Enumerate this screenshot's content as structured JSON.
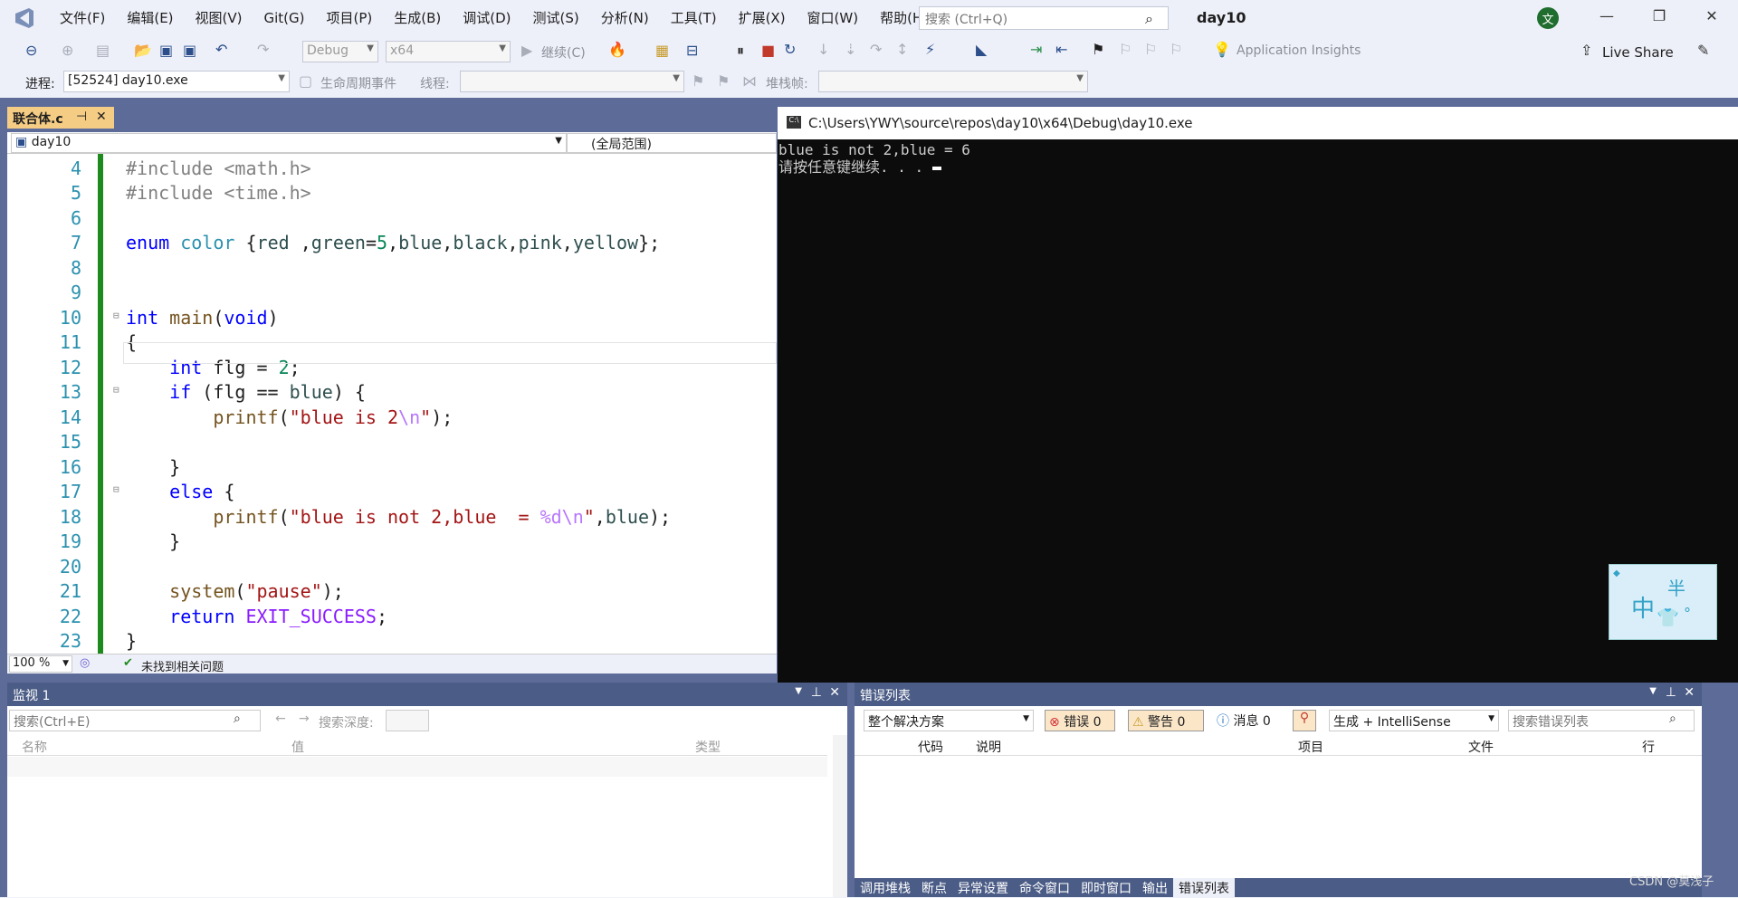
{
  "menu": [
    "文件(F)",
    "编辑(E)",
    "视图(V)",
    "Git(G)",
    "项目(P)",
    "生成(B)",
    "调试(D)",
    "测试(S)",
    "分析(N)",
    "工具(T)",
    "扩展(X)",
    "窗口(W)",
    "帮助(H)"
  ],
  "search": {
    "placeholder": "搜索 (Ctrl+Q)"
  },
  "solution_name": "day10",
  "user_initial": "文",
  "toolbar": {
    "config": "Debug",
    "platform": "x64",
    "continue_label": "继续(C)",
    "insights": "Application Insights",
    "live_share": "Live Share"
  },
  "toolbar2": {
    "process_label": "进程:",
    "process_value": "[52524] day10.exe",
    "lifecycle": "生命周期事件",
    "thread_label": "线程:",
    "stack_label": "堆栈帧:"
  },
  "editor": {
    "tab": "联合体.c",
    "project": "day10",
    "scope": "(全局范围)",
    "zoom": "100 %",
    "status": "未找到相关问题",
    "line_numbers": [
      "4",
      "5",
      "6",
      "7",
      "8",
      "9",
      "10",
      "11",
      "12",
      "13",
      "14",
      "15",
      "16",
      "17",
      "18",
      "19",
      "20",
      "21",
      "22",
      "23"
    ]
  },
  "console": {
    "title": "C:\\Users\\YWY\\source\\repos\\day10\\x64\\Debug\\day10.exe",
    "lines": [
      "blue is not 2,blue  = 6",
      "请按任意键继续. . . "
    ]
  },
  "watch": {
    "title": "监视 1",
    "search_placeholder": "搜索(Ctrl+E)",
    "depth_label": "搜索深度:",
    "columns": [
      "名称",
      "值",
      "类型"
    ]
  },
  "errors": {
    "title": "错误列表",
    "scope": "整个解决方案",
    "errors": "错误 0",
    "warnings": "警告 0",
    "messages": "消息 0",
    "source": "生成 + IntelliSense",
    "search_placeholder": "搜索错误列表",
    "columns": [
      "代码",
      "说明",
      "项目",
      "文件",
      "行"
    ]
  },
  "bottom_tabs": [
    "调用堆栈",
    "断点",
    "异常设置",
    "命令窗口",
    "即时窗口",
    "输出",
    "错误列表"
  ],
  "ime": {
    "big": "中",
    "small": "半",
    "extra": "°"
  },
  "watermark": "CSDN @莫浅子"
}
